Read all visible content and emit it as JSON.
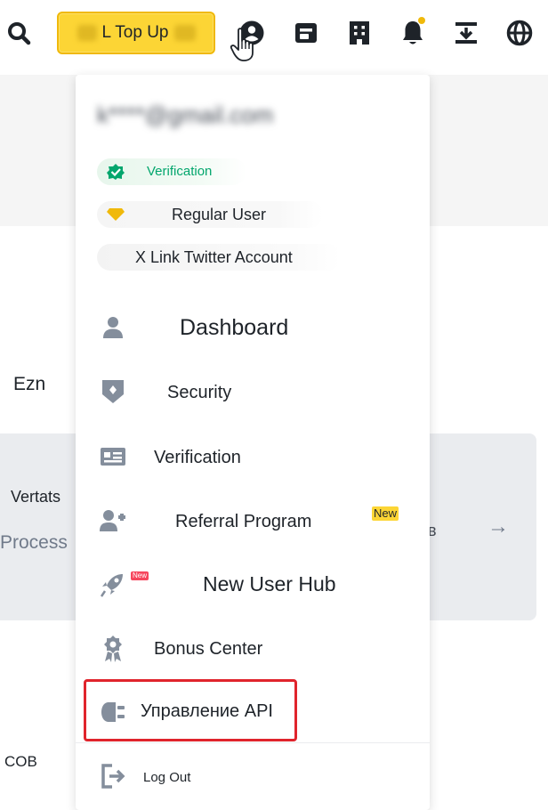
{
  "topbar": {
    "topup_label": "L Top Up",
    "icons": [
      "search-icon",
      "account-icon",
      "wallet-icon",
      "orders-icon",
      "notifications-icon",
      "download-icon",
      "globe-icon"
    ],
    "accent": "#fcd535"
  },
  "background": {
    "ezn": "Ezn",
    "vertats": "Vertats",
    "process": "Process",
    "b": "в",
    "arrow": "→",
    "cob": "COB"
  },
  "menu": {
    "email": "k****@gmail.com",
    "verification_badge": "Verification",
    "user_level": "Regular User",
    "twitter": "X Link Twitter Account",
    "items": [
      {
        "label": "Dashboard",
        "icon": "user-icon"
      },
      {
        "label": "Security",
        "icon": "shield-icon"
      },
      {
        "label": "Verification",
        "icon": "id-card-icon"
      },
      {
        "label": "Referral Program",
        "icon": "add-user-icon",
        "badge": "New"
      },
      {
        "label": "New User Hub",
        "icon": "rocket-icon",
        "tag": "New"
      },
      {
        "label": "Bonus Center",
        "icon": "medal-icon"
      },
      {
        "label": "Управление API",
        "icon": "api-plug-icon"
      }
    ],
    "logout": "Log Out"
  },
  "colors": {
    "brand_yellow": "#fcd535",
    "success_green": "#03a66d",
    "highlight_red": "#e0242c",
    "icon_grey": "#848e9c"
  }
}
